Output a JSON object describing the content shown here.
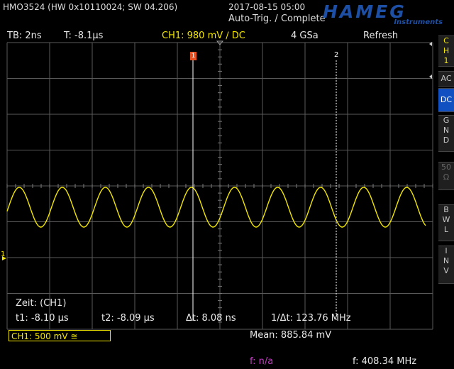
{
  "header": {
    "device": "HMO3524 (HW 0x10110024; SW 04.206)",
    "datetime": "2017-08-15 05:00",
    "trigger_status": "Auto-Trig. / Complete",
    "logo": "HAMEG",
    "logo_sub": "Instruments"
  },
  "status": {
    "timebase": "TB: 2ns",
    "trigger_time": "T: -8.1µs",
    "channel": "CH1: 980 mV ∕ DC",
    "sample_rate": "4 GSa",
    "mode": "Refresh"
  },
  "side_buttons": [
    {
      "label": [
        "C",
        "H",
        "1"
      ]
    },
    {
      "label": [
        "AC"
      ]
    },
    {
      "label": [
        "DC"
      ],
      "active": true
    },
    {
      "label": [
        "G",
        "N",
        "D"
      ]
    },
    {
      "label": [
        "50",
        "Ω"
      ],
      "disabled": true
    },
    {
      "label": [
        "B",
        "W",
        "L"
      ]
    },
    {
      "label": [
        "I",
        "N",
        "V"
      ]
    }
  ],
  "cursors": {
    "cursor1_label": "1",
    "cursor2_label": "2",
    "title": "Zeit: (CH1)",
    "t1": "t1: -8.10 µs",
    "t2": "t2: -8.09 µs",
    "dt": "Δt: 8.08 ns",
    "inv_dt": "1/Δt: 123.76 MHz"
  },
  "ground_marker": "1",
  "bottom": {
    "ch1_scale": "CH1: 500 mV ≅",
    "mean": "Mean: 885.84 mV",
    "f_na": "f: n/a",
    "freq": "f: 408.34 MHz"
  },
  "colors": {
    "trace": "#f2e600",
    "cursor1": "#e85020",
    "accent_blue": "#1050c0",
    "magenta": "#c040c0"
  }
}
